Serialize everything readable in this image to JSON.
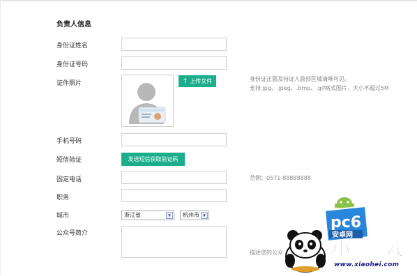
{
  "section": {
    "title": "负责人信息"
  },
  "fields": {
    "name_label": "身份证姓名",
    "id_label": "身份证号码",
    "photo_label": "证件照片",
    "phone_label": "手机号码",
    "sms_label": "短信验证",
    "landline_label": "固定电话",
    "position_label": "职务",
    "city_label": "城市",
    "intro_label": "公众号简介"
  },
  "photo": {
    "upload_button": "上传文件",
    "hint_line1": "身份证正面及持证人面部区域清晰可见。",
    "hint_line2": "支持.jpg、.jpeg、.bmp、.gif格式图片，大小不超过5M"
  },
  "sms": {
    "button": "发送短信获取验证码"
  },
  "landline": {
    "example": "范例：0571-88888888"
  },
  "city": {
    "province_selected": "浙江省",
    "city_selected": "杭州市"
  },
  "intro": {
    "hint": "描述您的公众"
  },
  "watermark": {
    "url": "www.xiaohei.com",
    "brand": "pc6",
    "brand_sub": "安卓网",
    "game_text": "小黑游戏"
  },
  "colors": {
    "accent": "#1cae8c"
  }
}
